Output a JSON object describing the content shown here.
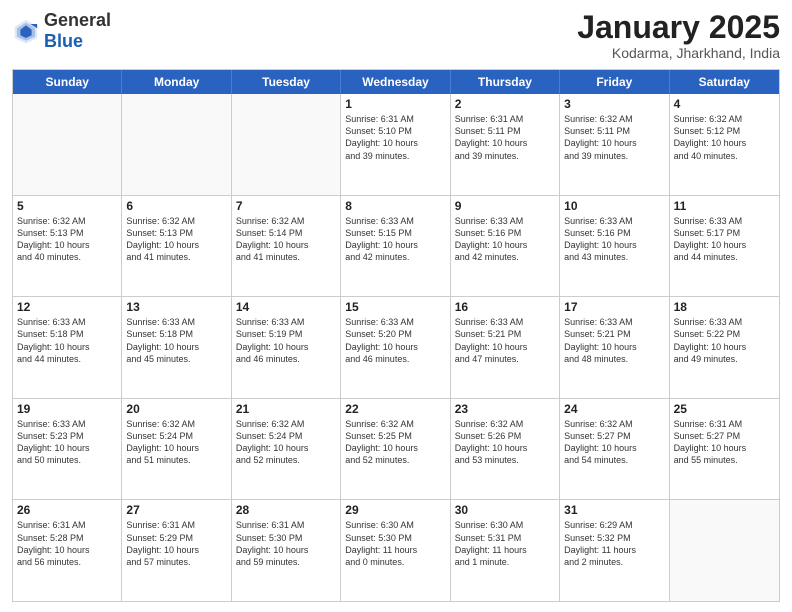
{
  "logo": {
    "general": "General",
    "blue": "Blue"
  },
  "header": {
    "month": "January 2025",
    "location": "Kodarma, Jharkhand, India"
  },
  "weekdays": [
    "Sunday",
    "Monday",
    "Tuesday",
    "Wednesday",
    "Thursday",
    "Friday",
    "Saturday"
  ],
  "rows": [
    [
      {
        "day": "",
        "info": ""
      },
      {
        "day": "",
        "info": ""
      },
      {
        "day": "",
        "info": ""
      },
      {
        "day": "1",
        "info": "Sunrise: 6:31 AM\nSunset: 5:10 PM\nDaylight: 10 hours\nand 39 minutes."
      },
      {
        "day": "2",
        "info": "Sunrise: 6:31 AM\nSunset: 5:11 PM\nDaylight: 10 hours\nand 39 minutes."
      },
      {
        "day": "3",
        "info": "Sunrise: 6:32 AM\nSunset: 5:11 PM\nDaylight: 10 hours\nand 39 minutes."
      },
      {
        "day": "4",
        "info": "Sunrise: 6:32 AM\nSunset: 5:12 PM\nDaylight: 10 hours\nand 40 minutes."
      }
    ],
    [
      {
        "day": "5",
        "info": "Sunrise: 6:32 AM\nSunset: 5:13 PM\nDaylight: 10 hours\nand 40 minutes."
      },
      {
        "day": "6",
        "info": "Sunrise: 6:32 AM\nSunset: 5:13 PM\nDaylight: 10 hours\nand 41 minutes."
      },
      {
        "day": "7",
        "info": "Sunrise: 6:32 AM\nSunset: 5:14 PM\nDaylight: 10 hours\nand 41 minutes."
      },
      {
        "day": "8",
        "info": "Sunrise: 6:33 AM\nSunset: 5:15 PM\nDaylight: 10 hours\nand 42 minutes."
      },
      {
        "day": "9",
        "info": "Sunrise: 6:33 AM\nSunset: 5:16 PM\nDaylight: 10 hours\nand 42 minutes."
      },
      {
        "day": "10",
        "info": "Sunrise: 6:33 AM\nSunset: 5:16 PM\nDaylight: 10 hours\nand 43 minutes."
      },
      {
        "day": "11",
        "info": "Sunrise: 6:33 AM\nSunset: 5:17 PM\nDaylight: 10 hours\nand 44 minutes."
      }
    ],
    [
      {
        "day": "12",
        "info": "Sunrise: 6:33 AM\nSunset: 5:18 PM\nDaylight: 10 hours\nand 44 minutes."
      },
      {
        "day": "13",
        "info": "Sunrise: 6:33 AM\nSunset: 5:18 PM\nDaylight: 10 hours\nand 45 minutes."
      },
      {
        "day": "14",
        "info": "Sunrise: 6:33 AM\nSunset: 5:19 PM\nDaylight: 10 hours\nand 46 minutes."
      },
      {
        "day": "15",
        "info": "Sunrise: 6:33 AM\nSunset: 5:20 PM\nDaylight: 10 hours\nand 46 minutes."
      },
      {
        "day": "16",
        "info": "Sunrise: 6:33 AM\nSunset: 5:21 PM\nDaylight: 10 hours\nand 47 minutes."
      },
      {
        "day": "17",
        "info": "Sunrise: 6:33 AM\nSunset: 5:21 PM\nDaylight: 10 hours\nand 48 minutes."
      },
      {
        "day": "18",
        "info": "Sunrise: 6:33 AM\nSunset: 5:22 PM\nDaylight: 10 hours\nand 49 minutes."
      }
    ],
    [
      {
        "day": "19",
        "info": "Sunrise: 6:33 AM\nSunset: 5:23 PM\nDaylight: 10 hours\nand 50 minutes."
      },
      {
        "day": "20",
        "info": "Sunrise: 6:32 AM\nSunset: 5:24 PM\nDaylight: 10 hours\nand 51 minutes."
      },
      {
        "day": "21",
        "info": "Sunrise: 6:32 AM\nSunset: 5:24 PM\nDaylight: 10 hours\nand 52 minutes."
      },
      {
        "day": "22",
        "info": "Sunrise: 6:32 AM\nSunset: 5:25 PM\nDaylight: 10 hours\nand 52 minutes."
      },
      {
        "day": "23",
        "info": "Sunrise: 6:32 AM\nSunset: 5:26 PM\nDaylight: 10 hours\nand 53 minutes."
      },
      {
        "day": "24",
        "info": "Sunrise: 6:32 AM\nSunset: 5:27 PM\nDaylight: 10 hours\nand 54 minutes."
      },
      {
        "day": "25",
        "info": "Sunrise: 6:31 AM\nSunset: 5:27 PM\nDaylight: 10 hours\nand 55 minutes."
      }
    ],
    [
      {
        "day": "26",
        "info": "Sunrise: 6:31 AM\nSunset: 5:28 PM\nDaylight: 10 hours\nand 56 minutes."
      },
      {
        "day": "27",
        "info": "Sunrise: 6:31 AM\nSunset: 5:29 PM\nDaylight: 10 hours\nand 57 minutes."
      },
      {
        "day": "28",
        "info": "Sunrise: 6:31 AM\nSunset: 5:30 PM\nDaylight: 10 hours\nand 59 minutes."
      },
      {
        "day": "29",
        "info": "Sunrise: 6:30 AM\nSunset: 5:30 PM\nDaylight: 11 hours\nand 0 minutes."
      },
      {
        "day": "30",
        "info": "Sunrise: 6:30 AM\nSunset: 5:31 PM\nDaylight: 11 hours\nand 1 minute."
      },
      {
        "day": "31",
        "info": "Sunrise: 6:29 AM\nSunset: 5:32 PM\nDaylight: 11 hours\nand 2 minutes."
      },
      {
        "day": "",
        "info": ""
      }
    ]
  ]
}
